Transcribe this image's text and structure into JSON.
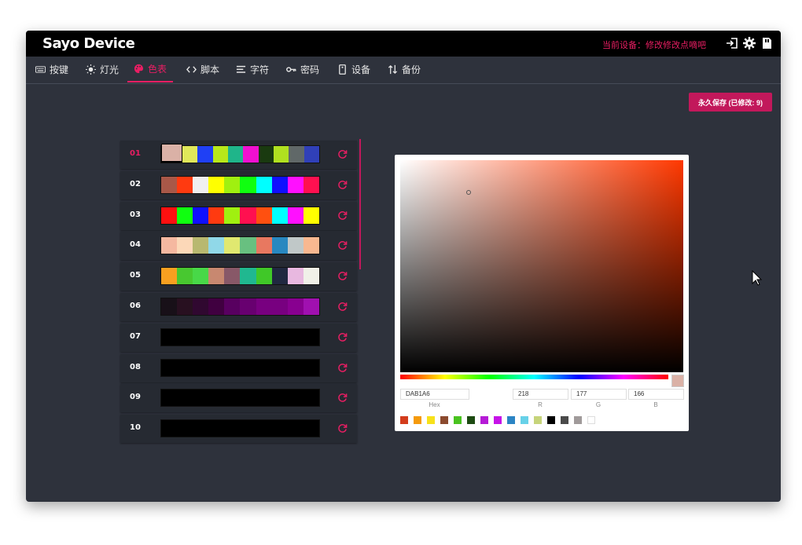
{
  "app": {
    "title": "Sayo Device"
  },
  "header": {
    "current_device": "当前设备：修改修改点嘀吧"
  },
  "tabs": [
    {
      "label": "按键",
      "icon": "keyboard-icon"
    },
    {
      "label": "灯光",
      "icon": "sun-icon"
    },
    {
      "label": "色表",
      "icon": "palette-icon",
      "active": true
    },
    {
      "label": "脚本",
      "icon": "code-icon"
    },
    {
      "label": "字符",
      "icon": "text-list-icon"
    },
    {
      "label": "密码",
      "icon": "key-icon"
    },
    {
      "label": "设备",
      "icon": "device-icon"
    },
    {
      "label": "备份",
      "icon": "sort-arrows-icon"
    }
  ],
  "save_button": {
    "label": "永久保存 (已修改: 9)"
  },
  "palettes": [
    {
      "id": "01",
      "active": true,
      "colors": [
        "#dab1a6",
        "#e0e85a",
        "#1f40f5",
        "#b8e81a",
        "#1fb58a",
        "#f010d0",
        "#1a3a10",
        "#b0e020",
        "#606868",
        "#3040b8"
      ]
    },
    {
      "id": "02",
      "colors": [
        "#a85848",
        "#ff3a10",
        "#f0f0f0",
        "#ffff00",
        "#a0f010",
        "#10ff10",
        "#00ffff",
        "#1010ff",
        "#ff10ff",
        "#ff1050"
      ]
    },
    {
      "id": "03",
      "colors": [
        "#ff1010",
        "#10ff10",
        "#1010ff",
        "#ff3a10",
        "#a0f010",
        "#ff1050",
        "#ff5010",
        "#00ffff",
        "#ff10ff",
        "#ffff00"
      ]
    },
    {
      "id": "04",
      "colors": [
        "#f5b8a0",
        "#fcd8b8",
        "#b8b870",
        "#90d8e8",
        "#e0e870",
        "#68c080",
        "#e87860",
        "#2888c0",
        "#c0c8c8",
        "#f8b890"
      ]
    },
    {
      "id": "05",
      "colors": [
        "#f8a020",
        "#48c830",
        "#48d848",
        "#c88870",
        "#885868",
        "#20b890",
        "#40c828",
        "#202840",
        "#e8b8e0",
        "#f0f0e8"
      ]
    },
    {
      "id": "06",
      "colors": [
        "#181018",
        "#281020",
        "#300830",
        "#400040",
        "#580060",
        "#680070",
        "#780080",
        "#780080",
        "#880090",
        "#a010b0"
      ]
    },
    {
      "id": "07",
      "colors": [
        "#000000"
      ]
    },
    {
      "id": "08",
      "colors": [
        "#000000"
      ]
    },
    {
      "id": "09",
      "colors": [
        "#000000"
      ]
    },
    {
      "id": "10",
      "colors": [
        "#000000"
      ]
    }
  ],
  "picker": {
    "hex": "DAB1A6",
    "r": "218",
    "g": "177",
    "b": "166",
    "labels": {
      "hex": "Hex",
      "r": "R",
      "g": "G",
      "b": "B"
    },
    "preview_color": "#dab1a6",
    "hue_color": "#ff3800",
    "presets": [
      "#d33c1c",
      "#f59a0c",
      "#f7e11a",
      "#8b4a2e",
      "#49c31f",
      "#1d4a12",
      "#b51ad6",
      "#c612e8",
      "#2b84c4",
      "#67d1e8",
      "#c6d47a",
      "#000000",
      "#4a4a4a",
      "#a09a9a",
      "#ffffff"
    ]
  },
  "colors": {
    "accent": "#e91e63",
    "bg": "#2e323c",
    "row_bg": "#262a32",
    "titlebar": "#000000"
  }
}
